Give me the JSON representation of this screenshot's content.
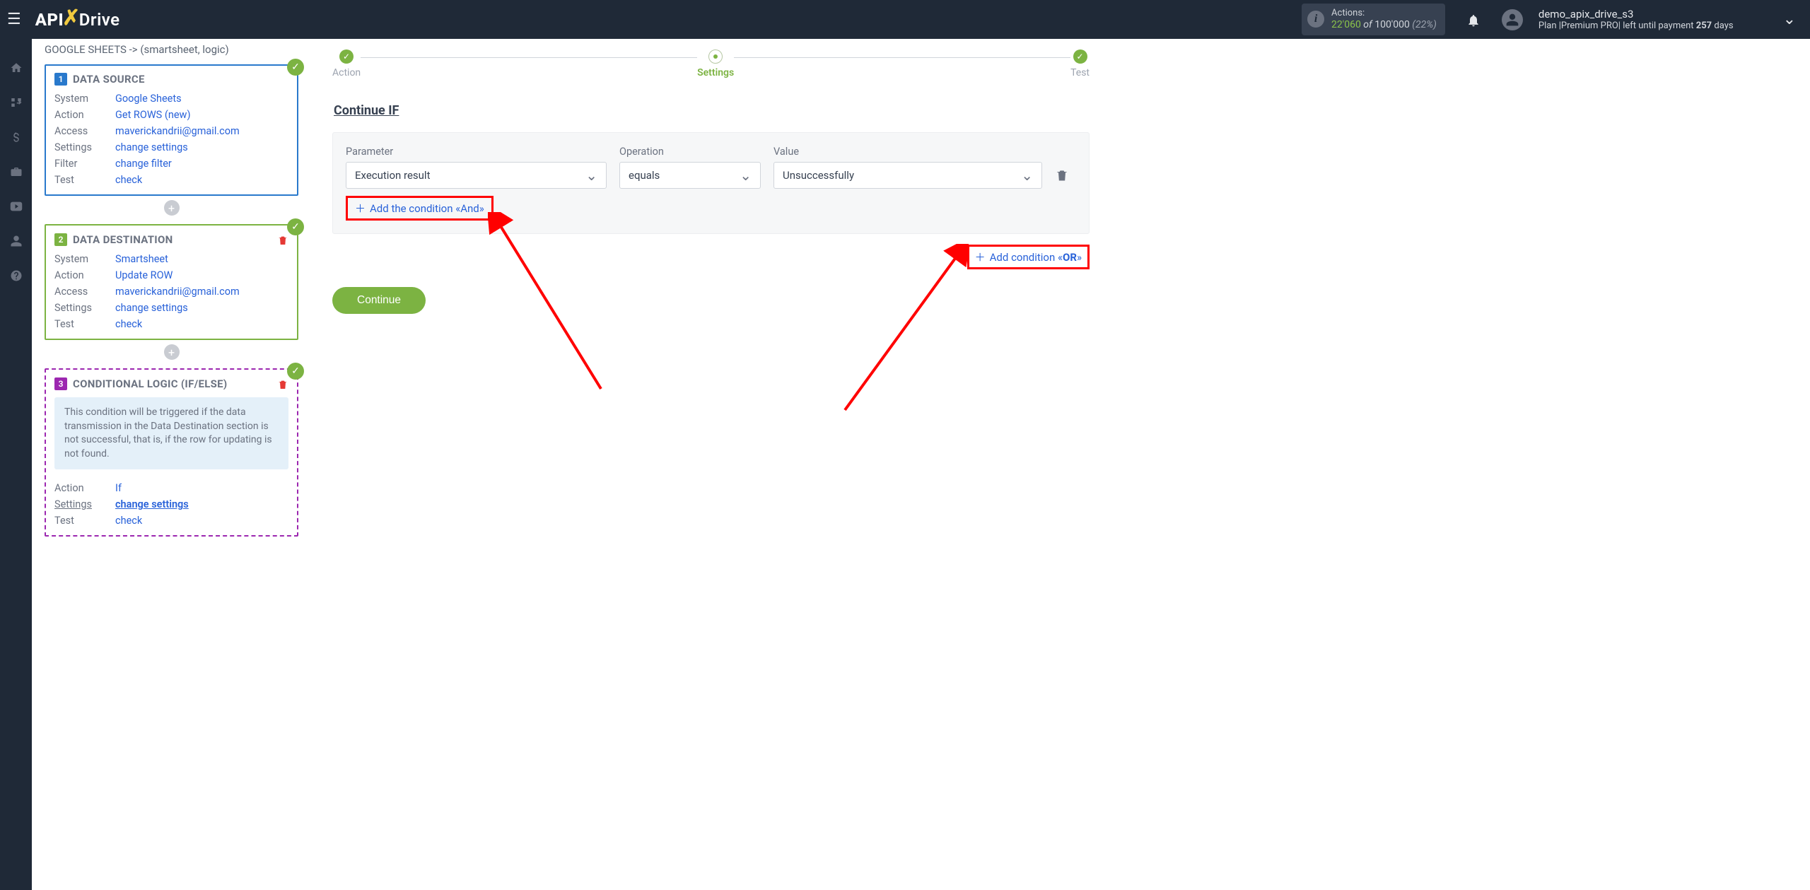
{
  "header": {
    "logo_parts": {
      "api": "API",
      "drive": "Drive"
    },
    "actions_label": "Actions:",
    "actions_count": "22'060",
    "actions_of": " of ",
    "actions_total": "100'000",
    "actions_pct": " (22%)",
    "username": "demo_apix_drive_s3",
    "plan_prefix": "Plan |Premium PRO| left until payment ",
    "plan_days": "257",
    "plan_suffix": " days"
  },
  "crumb": "GOOGLE SHEETS -> (smartsheet, logic)",
  "cards": {
    "source": {
      "num": "1",
      "title": "DATA SOURCE",
      "rows": [
        {
          "lbl": "System",
          "val": "Google Sheets"
        },
        {
          "lbl": "Action",
          "val": "Get ROWS (new)"
        },
        {
          "lbl": "Access",
          "val": "maverickandrii@gmail.com"
        },
        {
          "lbl": "Settings",
          "val": "change settings"
        },
        {
          "lbl": "Filter",
          "val": "change filter"
        },
        {
          "lbl": "Test",
          "val": "check"
        }
      ]
    },
    "dest": {
      "num": "2",
      "title": "DATA DESTINATION",
      "rows": [
        {
          "lbl": "System",
          "val": "Smartsheet"
        },
        {
          "lbl": "Action",
          "val": "Update ROW"
        },
        {
          "lbl": "Access",
          "val": "maverickandrii@gmail.com"
        },
        {
          "lbl": "Settings",
          "val": "change settings"
        },
        {
          "lbl": "Test",
          "val": "check"
        }
      ]
    },
    "logic": {
      "num": "3",
      "title": "CONDITIONAL LOGIC (IF/ELSE)",
      "info": "This condition will be triggered if the data transmission in the Data Destination section is not successful, that is, if the row for updating is not found.",
      "rows": [
        {
          "lbl": "Action",
          "val": "If"
        },
        {
          "lbl": "Settings",
          "val": "change settings",
          "emph": true
        },
        {
          "lbl": "Test",
          "val": "check"
        }
      ]
    }
  },
  "steps": {
    "action": "Action",
    "settings": "Settings",
    "test": "Test"
  },
  "main": {
    "continue_if": "Continue IF",
    "labels": {
      "param": "Parameter",
      "op": "Operation",
      "val": "Value"
    },
    "row": {
      "param": "Execution result",
      "op": "equals",
      "val": "Unsuccessfully"
    },
    "add_and": "Add the condition «And»",
    "add_or_prefix": "Add condition «",
    "add_or_bold": "OR",
    "add_or_suffix": "»",
    "continue_btn": "Continue"
  }
}
